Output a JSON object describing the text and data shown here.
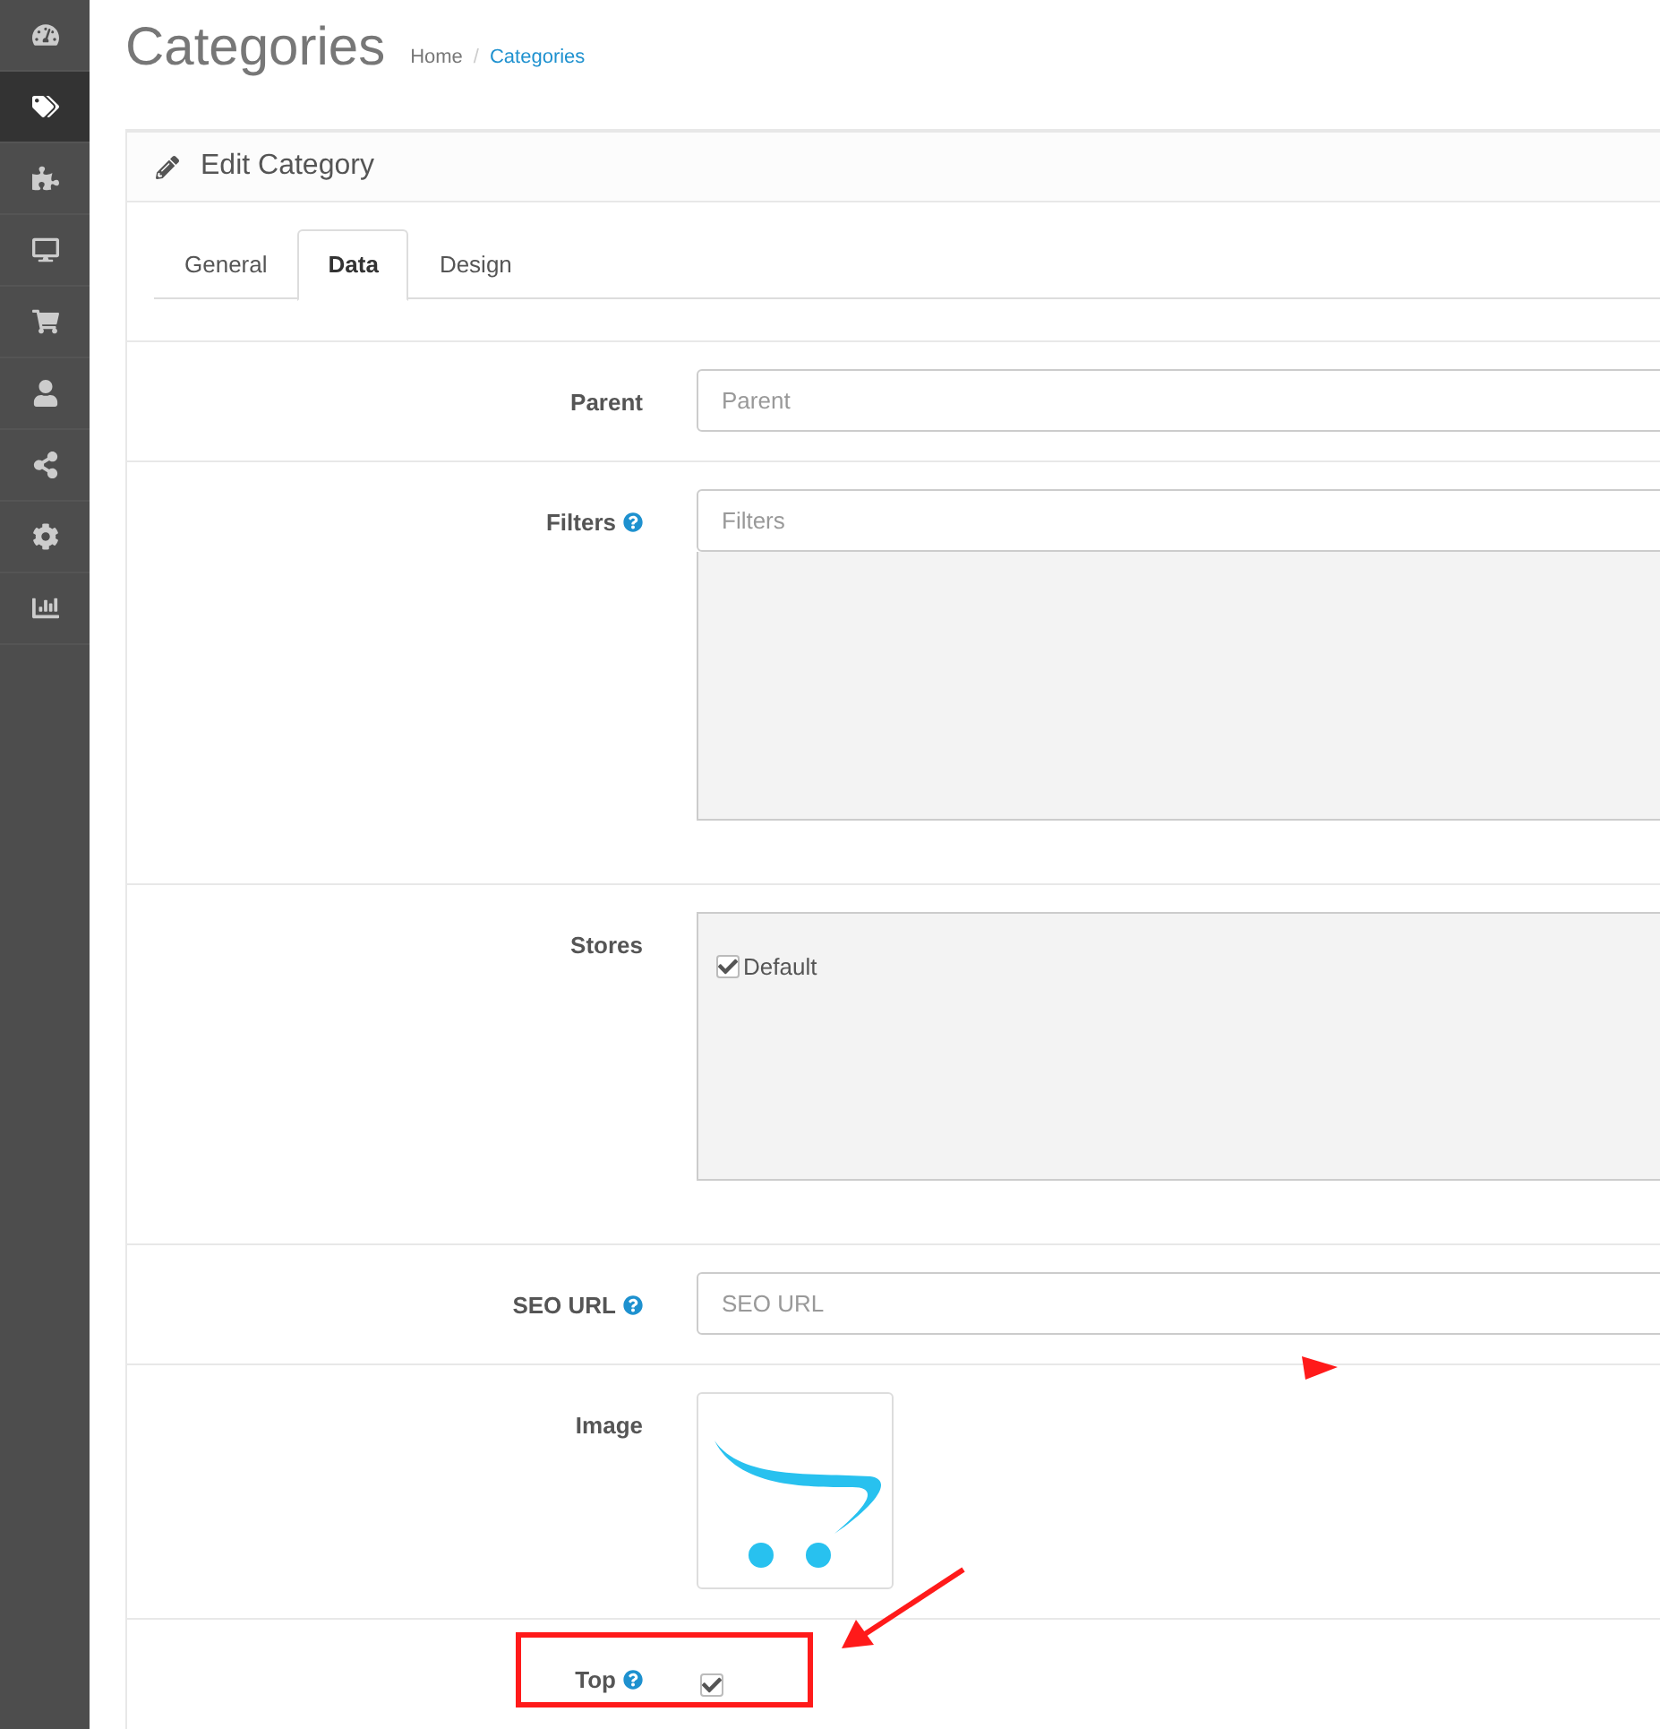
{
  "sidebar": {
    "items": [
      {
        "selected": false
      },
      {
        "selected": true
      },
      {
        "selected": false
      },
      {
        "selected": false
      },
      {
        "selected": false
      },
      {
        "selected": false
      },
      {
        "selected": false
      },
      {
        "selected": false
      },
      {
        "selected": false
      }
    ]
  },
  "page_title": "Categories",
  "breadcrumb": {
    "separator": "/",
    "items": [
      "Home",
      "Categories"
    ]
  },
  "panel": {
    "title": "Edit Category"
  },
  "tabs": [
    {
      "label": "General",
      "selected": false
    },
    {
      "label": "Data",
      "selected": true
    },
    {
      "label": "Design",
      "selected": false
    }
  ],
  "fields": [
    {
      "kind": "text",
      "label": "Parent",
      "help": false,
      "placeholder": "Parent"
    },
    {
      "kind": "autocomplete",
      "label": "Filters",
      "help": true,
      "placeholder": "Filters"
    },
    {
      "kind": "stores",
      "label": "Stores",
      "help": false,
      "stores": [
        {
          "name": "Default",
          "checked": true
        }
      ]
    },
    {
      "kind": "text",
      "label": "SEO URL",
      "help": true,
      "placeholder": "SEO URL"
    },
    {
      "kind": "image",
      "label": "Image",
      "help": false
    },
    {
      "kind": "checkbox",
      "label": "Top",
      "help": true,
      "checked": true
    }
  ]
}
